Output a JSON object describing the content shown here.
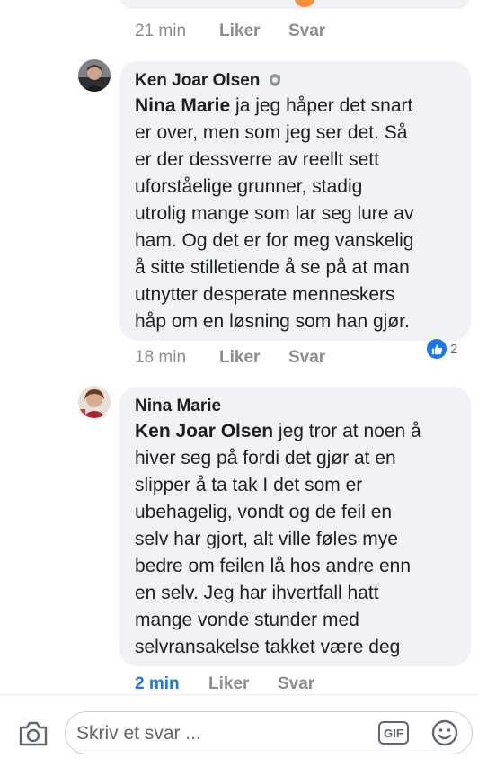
{
  "comment0": {
    "time": "21 min",
    "like_label": "Liker",
    "reply_label": "Svar"
  },
  "comment1": {
    "author": "Ken Joar Olsen",
    "author_badge_icon": "shield-icon",
    "mention": "Nina Marie",
    "lines": [
      " ja jeg håper det snart",
      "er over, men som jeg ser det. Så",
      "er der dessverre av reellt sett",
      "uforståelige grunner, stadig",
      "utrolig mange som lar seg lure av",
      "ham. Og det er for meg vanskelig",
      "å sitte stilletiende å se på at man",
      "utnytter desperate menneskers",
      "håp om en løsning som han gjør."
    ],
    "reaction_count": "2",
    "time": "18 min",
    "like_label": "Liker",
    "reply_label": "Svar"
  },
  "comment2": {
    "author": "Nina Marie",
    "mention": "Ken Joar Olsen",
    "lines": [
      " jeg tror at noen å",
      "hiver seg på fordi det gjør at en",
      "slipper å ta tak I det som er",
      "ubehagelig, vondt og de feil en",
      "selv har gjort, alt ville føles mye",
      "bedre om feilen lå hos andre enn",
      "en selv. Jeg har ihvertfall hatt",
      "mange vonde stunder med",
      "selvransakelse takket være deg"
    ],
    "time": "2 min",
    "like_label": "Liker",
    "reply_label": "Svar"
  },
  "composer": {
    "placeholder": "Skriv et svar ...",
    "gif_label": "GIF",
    "camera_icon": "camera-icon",
    "emoji_icon": "emoji-icon"
  },
  "colors": {
    "bubble": "#f0f2f5",
    "accent": "#1877f2",
    "meta": "#8a8d91"
  }
}
